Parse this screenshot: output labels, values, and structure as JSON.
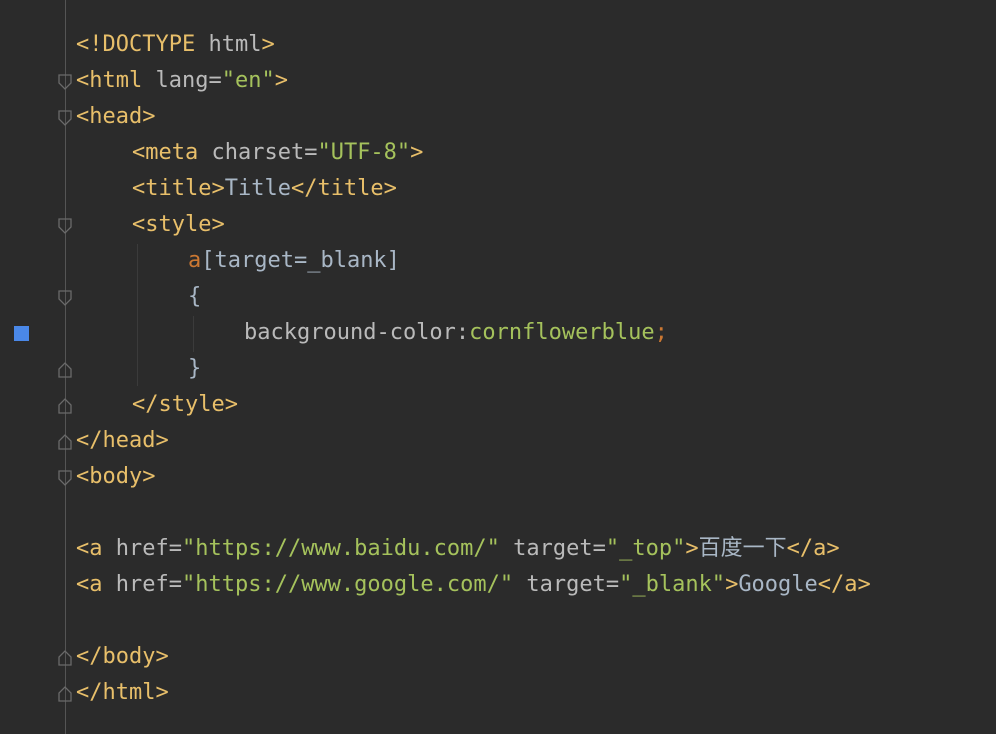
{
  "code": {
    "l1": [
      "<!DOCTYPE",
      " html",
      ">"
    ],
    "l2": [
      "<html",
      " lang=",
      "\"en\"",
      ">"
    ],
    "l3": [
      "<head>"
    ],
    "l4": [
      "<meta",
      " charset=",
      "\"UTF-8\"",
      ">"
    ],
    "l5": [
      "<title>",
      "Title",
      "</title>"
    ],
    "l6": [
      "<style>"
    ],
    "l7": [
      "a",
      "[target=_blank]"
    ],
    "l8": [
      "{"
    ],
    "l9": [
      "background-color:",
      "cornflowerblue",
      ";"
    ],
    "l10": [
      "}"
    ],
    "l11": [
      "</style>"
    ],
    "l12": [
      "</head>"
    ],
    "l13": [
      "<body>"
    ],
    "l15": [
      "<a",
      " href=",
      "\"https://www.baidu.com/\"",
      " target=",
      "\"_top\"",
      ">",
      "百度一下",
      "</a>"
    ],
    "l16": [
      "<a",
      " href=",
      "\"https://www.google.com/\"",
      " target=",
      "\"_blank\"",
      ">",
      "Google",
      "</a>"
    ],
    "l18": [
      "</body>"
    ],
    "l19": [
      "</html>"
    ]
  },
  "colors": {
    "background": "#2b2b2b",
    "tag": "#e8bf6a",
    "attribute": "#bababa",
    "string": "#a5c25c",
    "text": "#a9b7c6",
    "keyword": "#cc7832",
    "bookmark": "#4a88e8"
  },
  "icons": {
    "bookmark": "bookmark-marker-icon",
    "fold_open": "fold-open-icon",
    "fold_close": "fold-close-icon"
  }
}
